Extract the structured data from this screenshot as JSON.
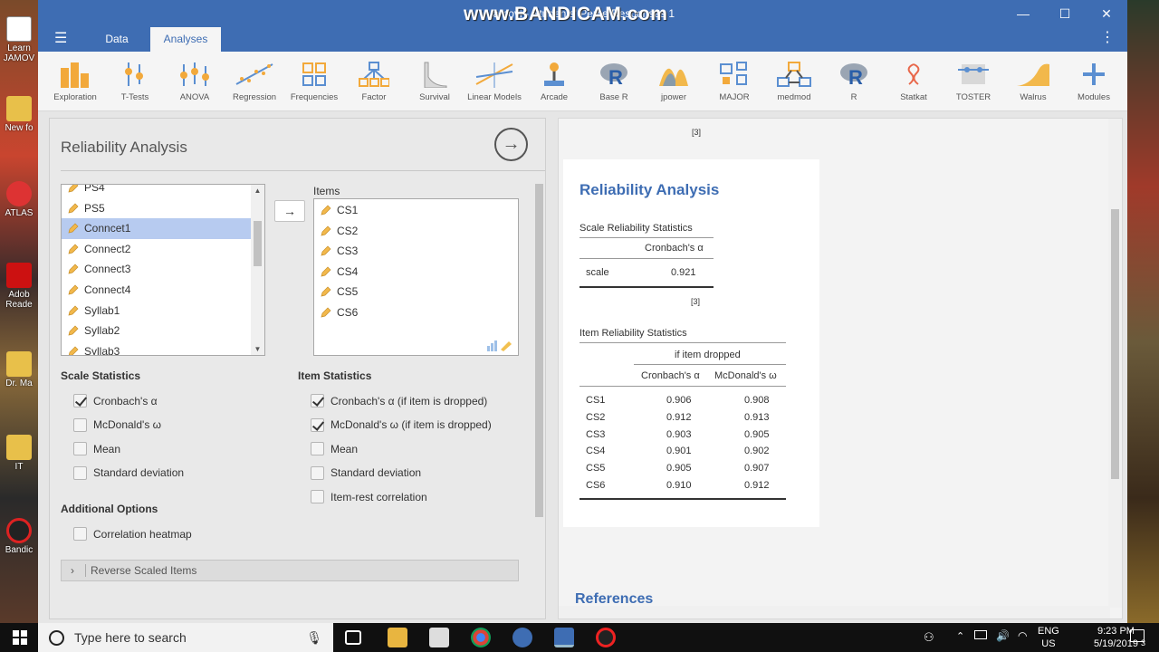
{
  "window": {
    "title": "jamovi - Students' Perce                                      Responses 1",
    "watermark": "www.BANDICAM.com",
    "minimize": "—",
    "maximize": "☐",
    "close": "✕"
  },
  "tabs": [
    {
      "label": "Data"
    },
    {
      "label": "Analyses"
    }
  ],
  "ribbon": [
    {
      "label": "Exploration",
      "icon": "exploration-icon"
    },
    {
      "label": "T-Tests",
      "icon": "ttests-icon"
    },
    {
      "label": "ANOVA",
      "icon": "anova-icon"
    },
    {
      "label": "Regression",
      "icon": "regression-icon"
    },
    {
      "label": "Frequencies",
      "icon": "frequencies-icon"
    },
    {
      "label": "Factor",
      "icon": "factor-icon"
    },
    {
      "label": "Survival",
      "icon": "survival-icon"
    },
    {
      "label": "Linear Models",
      "icon": "linear-models-icon"
    },
    {
      "label": "Arcade",
      "icon": "arcade-icon"
    },
    {
      "label": "Base R",
      "icon": "base-r-icon"
    },
    {
      "label": "jpower",
      "icon": "jpower-icon"
    },
    {
      "label": "MAJOR",
      "icon": "major-icon"
    },
    {
      "label": "medmod",
      "icon": "medmod-icon"
    },
    {
      "label": "R",
      "icon": "r-icon"
    },
    {
      "label": "Statkat",
      "icon": "statkat-icon"
    },
    {
      "label": "TOSTER",
      "icon": "toster-icon"
    },
    {
      "label": "Walrus",
      "icon": "walrus-icon"
    },
    {
      "label": "Modules",
      "icon": "modules-icon"
    }
  ],
  "options": {
    "title": "Reliability Analysis",
    "go_symbol": "→",
    "source_vars": [
      "PS4",
      "PS5",
      "Conncet1",
      "Connect2",
      "Connect3",
      "Connect4",
      "Syllab1",
      "Syllab2",
      "Syllab3"
    ],
    "selected_var": "Conncet1",
    "move_arrow": "→",
    "items_label": "Items",
    "items": [
      "CS1",
      "CS2",
      "CS3",
      "CS4",
      "CS5",
      "CS6"
    ],
    "scale_stats_header": "Scale Statistics",
    "scale_stats": [
      {
        "label": "Cronbach's α",
        "checked": true
      },
      {
        "label": "McDonald's ω",
        "checked": false
      },
      {
        "label": "Mean",
        "checked": false
      },
      {
        "label": "Standard deviation",
        "checked": false
      }
    ],
    "item_stats_header": "Item Statistics",
    "item_stats": [
      {
        "label": "Cronbach's α (if item is dropped)",
        "checked": true
      },
      {
        "label": "McDonald's ω (if item is dropped)",
        "checked": true
      },
      {
        "label": "Mean",
        "checked": false
      },
      {
        "label": "Standard deviation",
        "checked": false
      },
      {
        "label": "Item-rest correlation",
        "checked": false
      }
    ],
    "additional_header": "Additional Options",
    "additional": [
      {
        "label": "Correlation heatmap",
        "checked": false
      }
    ],
    "reverse_label": "Reverse Scaled Items",
    "reverse_chevron": "›"
  },
  "results": {
    "ref_top": "[3]",
    "title": "Reliability Analysis",
    "scale_table": {
      "caption": "Scale Reliability Statistics",
      "col": "Cronbach's α",
      "row_label": "scale",
      "row_value": "0.921",
      "ref": "[3]"
    },
    "item_table": {
      "caption": "Item Reliability Statistics",
      "span_header": "if item dropped",
      "cols": [
        "Cronbach's α",
        "McDonald's ω"
      ],
      "rows": [
        {
          "item": "CS1",
          "alpha": "0.906",
          "omega": "0.908"
        },
        {
          "item": "CS2",
          "alpha": "0.912",
          "omega": "0.913"
        },
        {
          "item": "CS3",
          "alpha": "0.903",
          "omega": "0.905"
        },
        {
          "item": "CS4",
          "alpha": "0.901",
          "omega": "0.902"
        },
        {
          "item": "CS5",
          "alpha": "0.905",
          "omega": "0.907"
        },
        {
          "item": "CS6",
          "alpha": "0.910",
          "omega": "0.912"
        }
      ]
    },
    "references": "References"
  },
  "desktop_left": [
    {
      "label": "Learn JAMOV"
    },
    {
      "label": "New fo"
    },
    {
      "label": "ATLAS"
    },
    {
      "label": "Adob Reade"
    },
    {
      "label": "Dr. Ma"
    },
    {
      "label": "IT"
    },
    {
      "label": "Bandic"
    }
  ],
  "taskbar": {
    "search_placeholder": "Type here to search",
    "lang_top": "ENG",
    "lang_bottom": "US",
    "time": "9:23 PM",
    "date": "5/19/2019",
    "notifications": "3"
  },
  "colors": {
    "accent": "#3e6db3",
    "selection": "#b7cbf0"
  }
}
